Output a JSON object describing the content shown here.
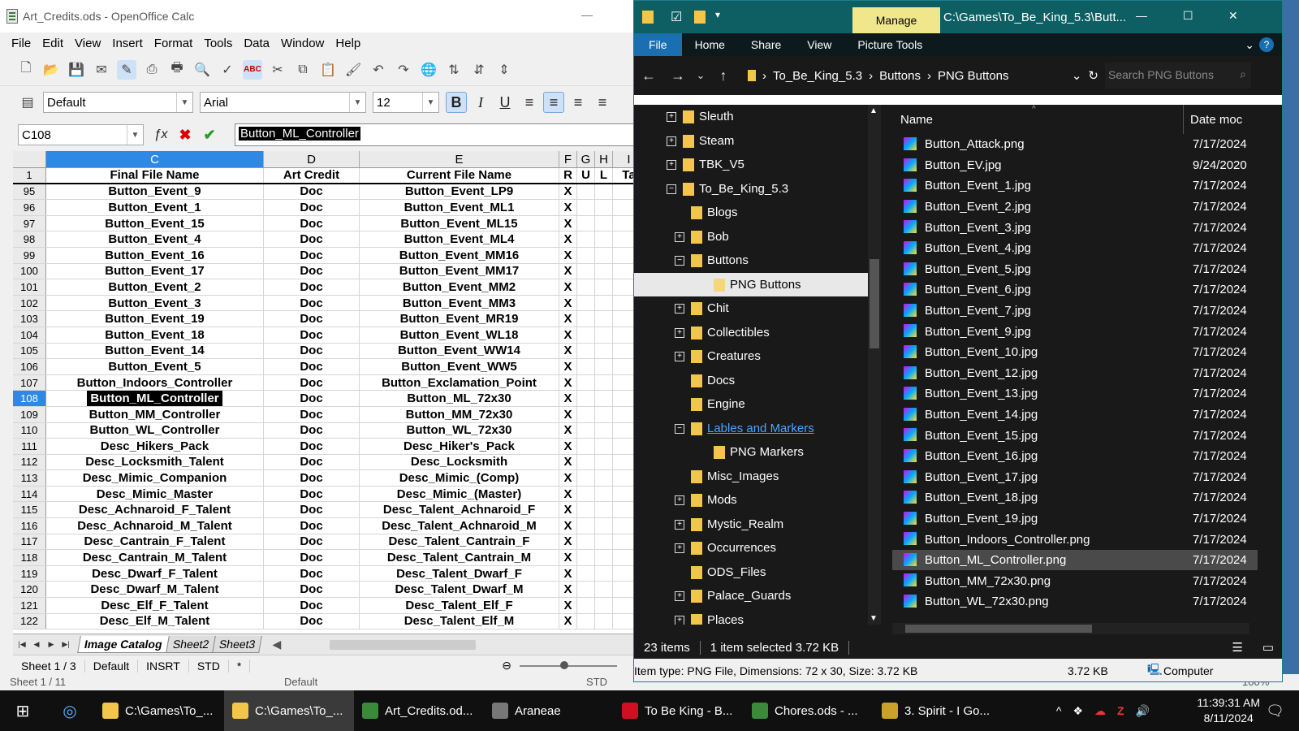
{
  "calc": {
    "title": "Art_Credits.ods - OpenOffice Calc",
    "menu": [
      "File",
      "Edit",
      "View",
      "Insert",
      "Format",
      "Tools",
      "Data",
      "Window",
      "Help"
    ],
    "style": "Default",
    "font": "Arial",
    "size": "12",
    "cellref": "C108",
    "formula": "Button_ML_Controller",
    "columns": [
      "C",
      "D",
      "E",
      "F",
      "G",
      "H",
      "I"
    ],
    "header_row": {
      "num": "1",
      "c": "Final File Name",
      "d": "Art Credit",
      "e": "Current File Name",
      "f": "R",
      "g": "U",
      "h": "L",
      "i": "Ta"
    },
    "rows": [
      {
        "n": "95",
        "c": "Button_Event_9",
        "d": "Doc",
        "e": "Button_Event_LP9",
        "f": "X"
      },
      {
        "n": "96",
        "c": "Button_Event_1",
        "d": "Doc",
        "e": "Button_Event_ML1",
        "f": "X"
      },
      {
        "n": "97",
        "c": "Button_Event_15",
        "d": "Doc",
        "e": "Button_Event_ML15",
        "f": "X"
      },
      {
        "n": "98",
        "c": "Button_Event_4",
        "d": "Doc",
        "e": "Button_Event_ML4",
        "f": "X"
      },
      {
        "n": "99",
        "c": "Button_Event_16",
        "d": "Doc",
        "e": "Button_Event_MM16",
        "f": "X"
      },
      {
        "n": "100",
        "c": "Button_Event_17",
        "d": "Doc",
        "e": "Button_Event_MM17",
        "f": "X"
      },
      {
        "n": "101",
        "c": "Button_Event_2",
        "d": "Doc",
        "e": "Button_Event_MM2",
        "f": "X"
      },
      {
        "n": "102",
        "c": "Button_Event_3",
        "d": "Doc",
        "e": "Button_Event_MM3",
        "f": "X"
      },
      {
        "n": "103",
        "c": "Button_Event_19",
        "d": "Doc",
        "e": "Button_Event_MR19",
        "f": "X"
      },
      {
        "n": "104",
        "c": "Button_Event_18",
        "d": "Doc",
        "e": "Button_Event_WL18",
        "f": "X"
      },
      {
        "n": "105",
        "c": "Button_Event_14",
        "d": "Doc",
        "e": "Button_Event_WW14",
        "f": "X"
      },
      {
        "n": "106",
        "c": "Button_Event_5",
        "d": "Doc",
        "e": "Button_Event_WW5",
        "f": "X"
      },
      {
        "n": "107",
        "c": "Button_Indoors_Controller",
        "d": "Doc",
        "e": "Button_Exclamation_Point",
        "f": "X"
      },
      {
        "n": "108",
        "c": "Button_ML_Controller",
        "d": "Doc",
        "e": "Button_ML_72x30",
        "f": "X"
      },
      {
        "n": "109",
        "c": "Button_MM_Controller",
        "d": "Doc",
        "e": "Button_MM_72x30",
        "f": "X"
      },
      {
        "n": "110",
        "c": "Button_WL_Controller",
        "d": "Doc",
        "e": "Button_WL_72x30",
        "f": "X"
      },
      {
        "n": "111",
        "c": "Desc_Hikers_Pack",
        "d": "Doc",
        "e": "Desc_Hiker's_Pack",
        "f": "X"
      },
      {
        "n": "112",
        "c": "Desc_Locksmith_Talent",
        "d": "Doc",
        "e": "Desc_Locksmith",
        "f": "X"
      },
      {
        "n": "113",
        "c": "Desc_Mimic_Companion",
        "d": "Doc",
        "e": "Desc_Mimic_(Comp)",
        "f": "X"
      },
      {
        "n": "114",
        "c": "Desc_Mimic_Master",
        "d": "Doc",
        "e": "Desc_Mimic_(Master)",
        "f": "X"
      },
      {
        "n": "115",
        "c": "Desc_Achnaroid_F_Talent",
        "d": "Doc",
        "e": "Desc_Talent_Achnaroid_F",
        "f": "X"
      },
      {
        "n": "116",
        "c": "Desc_Achnaroid_M_Talent",
        "d": "Doc",
        "e": "Desc_Talent_Achnaroid_M",
        "f": "X"
      },
      {
        "n": "117",
        "c": "Desc_Cantrain_F_Talent",
        "d": "Doc",
        "e": "Desc_Talent_Cantrain_F",
        "f": "X"
      },
      {
        "n": "118",
        "c": "Desc_Cantrain_M_Talent",
        "d": "Doc",
        "e": "Desc_Talent_Cantrain_M",
        "f": "X"
      },
      {
        "n": "119",
        "c": "Desc_Dwarf_F_Talent",
        "d": "Doc",
        "e": "Desc_Talent_Dwarf_F",
        "f": "X"
      },
      {
        "n": "120",
        "c": "Desc_Dwarf_M_Talent",
        "d": "Doc",
        "e": "Desc_Talent_Dwarf_M",
        "f": "X"
      },
      {
        "n": "121",
        "c": "Desc_Elf_F_Talent",
        "d": "Doc",
        "e": "Desc_Talent_Elf_F",
        "f": "X"
      },
      {
        "n": "122",
        "c": "Desc_Elf_M_Talent",
        "d": "Doc",
        "e": "Desc_Talent_Elf_M",
        "f": "X"
      }
    ],
    "sheets": [
      "Image Catalog",
      "Sheet2",
      "Sheet3"
    ],
    "status": {
      "sheet": "Sheet 1 / 3",
      "style": "Default",
      "mode": "INSRT",
      "sel": "STD",
      "mod": "*"
    },
    "underbar": {
      "sheet": "Sheet 1 / 11",
      "style": "Default",
      "sel": "STD",
      "zoom": "100%"
    }
  },
  "explorer": {
    "manage": "Manage",
    "path": "C:\\Games\\To_Be_King_5.3\\Butt...",
    "tabs": [
      "File",
      "Home",
      "Share",
      "View",
      "Picture Tools"
    ],
    "crumbs": [
      "To_Be_King_5.3",
      "Buttons",
      "PNG Buttons"
    ],
    "search_placeholder": "Search PNG Buttons",
    "tree": [
      {
        "label": "Sleuth",
        "level": 0,
        "exp": "+"
      },
      {
        "label": "Steam",
        "level": 0,
        "exp": "+"
      },
      {
        "label": "TBK_V5",
        "level": 0,
        "exp": "+"
      },
      {
        "label": "To_Be_King_5.3",
        "level": 0,
        "exp": "−"
      },
      {
        "label": "Blogs",
        "level": 1,
        "exp": ""
      },
      {
        "label": "Bob",
        "level": 1,
        "exp": "+"
      },
      {
        "label": "Buttons",
        "level": 1,
        "exp": "−"
      },
      {
        "label": "PNG Buttons",
        "level": 2,
        "exp": "",
        "sel": true
      },
      {
        "label": "Chit",
        "level": 1,
        "exp": "+"
      },
      {
        "label": "Collectibles",
        "level": 1,
        "exp": "+"
      },
      {
        "label": "Creatures",
        "level": 1,
        "exp": "+"
      },
      {
        "label": "Docs",
        "level": 1,
        "exp": ""
      },
      {
        "label": "Engine",
        "level": 1,
        "exp": ""
      },
      {
        "label": "Lables and Markers",
        "level": 1,
        "exp": "−",
        "link": true
      },
      {
        "label": "PNG Markers",
        "level": 2,
        "exp": ""
      },
      {
        "label": "Misc_Images",
        "level": 1,
        "exp": ""
      },
      {
        "label": "Mods",
        "level": 1,
        "exp": "+"
      },
      {
        "label": "Mystic_Realm",
        "level": 1,
        "exp": "+"
      },
      {
        "label": "Occurrences",
        "level": 1,
        "exp": "+"
      },
      {
        "label": "ODS_Files",
        "level": 1,
        "exp": ""
      },
      {
        "label": "Palace_Guards",
        "level": 1,
        "exp": "+"
      },
      {
        "label": "Places",
        "level": 1,
        "exp": "+"
      }
    ],
    "col_name": "Name",
    "col_date": "Date moc",
    "files": [
      {
        "name": "Button_Attack.png",
        "date": "7/17/2024"
      },
      {
        "name": "Button_EV.jpg",
        "date": "9/24/2020"
      },
      {
        "name": "Button_Event_1.jpg",
        "date": "7/17/2024"
      },
      {
        "name": "Button_Event_2.jpg",
        "date": "7/17/2024"
      },
      {
        "name": "Button_Event_3.jpg",
        "date": "7/17/2024"
      },
      {
        "name": "Button_Event_4.jpg",
        "date": "7/17/2024"
      },
      {
        "name": "Button_Event_5.jpg",
        "date": "7/17/2024"
      },
      {
        "name": "Button_Event_6.jpg",
        "date": "7/17/2024"
      },
      {
        "name": "Button_Event_7.jpg",
        "date": "7/17/2024"
      },
      {
        "name": "Button_Event_9.jpg",
        "date": "7/17/2024"
      },
      {
        "name": "Button_Event_10.jpg",
        "date": "7/17/2024"
      },
      {
        "name": "Button_Event_12.jpg",
        "date": "7/17/2024"
      },
      {
        "name": "Button_Event_13.jpg",
        "date": "7/17/2024"
      },
      {
        "name": "Button_Event_14.jpg",
        "date": "7/17/2024"
      },
      {
        "name": "Button_Event_15.jpg",
        "date": "7/17/2024"
      },
      {
        "name": "Button_Event_16.jpg",
        "date": "7/17/2024"
      },
      {
        "name": "Button_Event_17.jpg",
        "date": "7/17/2024"
      },
      {
        "name": "Button_Event_18.jpg",
        "date": "7/17/2024"
      },
      {
        "name": "Button_Event_19.jpg",
        "date": "7/17/2024"
      },
      {
        "name": "Button_Indoors_Controller.png",
        "date": "7/17/2024"
      },
      {
        "name": "Button_ML_Controller.png",
        "date": "7/17/2024",
        "sel": true
      },
      {
        "name": "Button_MM_72x30.png",
        "date": "7/17/2024"
      },
      {
        "name": "Button_WL_72x30.png",
        "date": "7/17/2024"
      }
    ],
    "status": {
      "items": "23 items",
      "selected": "1 item selected  3.72 KB"
    },
    "info": {
      "type": "Item type: PNG File, Dimensions: 72 x 30, Size: 3.72 KB",
      "size": "3.72 KB",
      "location": "Computer"
    }
  },
  "taskbar": {
    "items": [
      {
        "label": "C:\\Games\\To_...",
        "color": "#f3c54a"
      },
      {
        "label": "C:\\Games\\To_...",
        "color": "#f3c54a",
        "active": true
      },
      {
        "label": "Art_Credits.od...",
        "color": "#3a8a3a"
      },
      {
        "label": "Araneae",
        "color": "#777777"
      },
      {
        "label": "To Be King - B...",
        "color": "#d01020"
      },
      {
        "label": "Chores.ods - ...",
        "color": "#3a8a3a"
      },
      {
        "label": "3. Spirit - I Go...",
        "color": "#c9a227"
      }
    ],
    "time": "11:39:31 AM",
    "date": "8/11/2024"
  }
}
